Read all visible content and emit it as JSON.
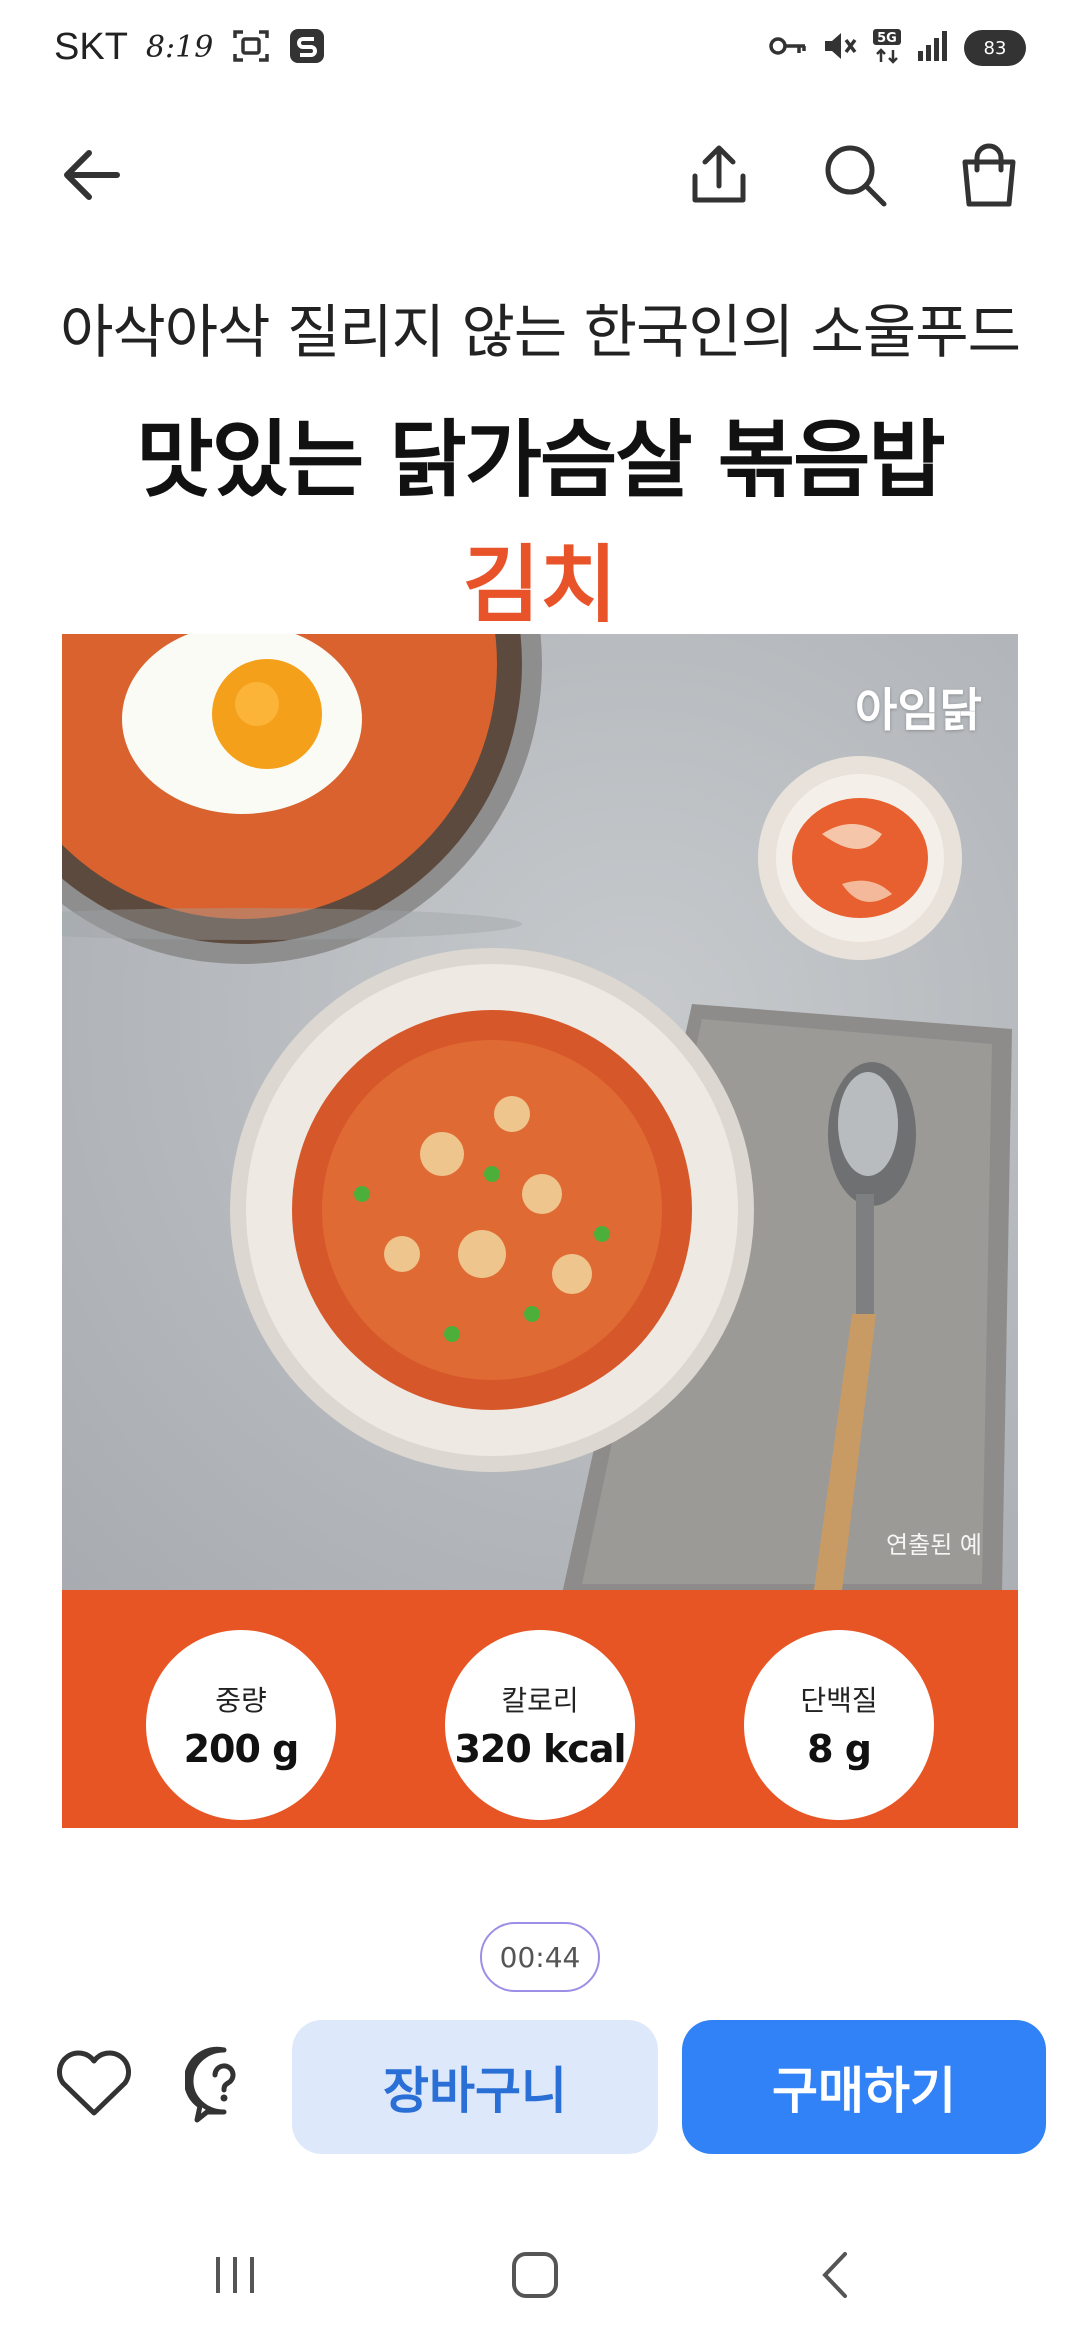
{
  "status_bar": {
    "carrier": "SKT",
    "time": "8:19",
    "network": "5G",
    "battery": "83"
  },
  "product": {
    "subtitle": "아삭아삭 질리지 않는 한국인의 소울푸드",
    "title": "맛있는 닭가슴살 볶음밥",
    "flavor": "김치",
    "brand": "아임닭",
    "image_caption": "연출된 예",
    "accent_color": "#e85524"
  },
  "nutrition": [
    {
      "label": "중량",
      "value": "200 g"
    },
    {
      "label": "칼로리",
      "value": "320 kcal"
    },
    {
      "label": "단백질",
      "value": "8 g"
    }
  ],
  "timer": "00:44",
  "actions": {
    "cart_label": "장바구니",
    "buy_label": "구매하기",
    "buy_color": "#3182f6"
  },
  "icons": {
    "back": "back-arrow-icon",
    "share": "share-icon",
    "search": "search-icon",
    "bag": "shopping-bag-icon",
    "heart": "heart-icon",
    "help": "question-icon"
  }
}
